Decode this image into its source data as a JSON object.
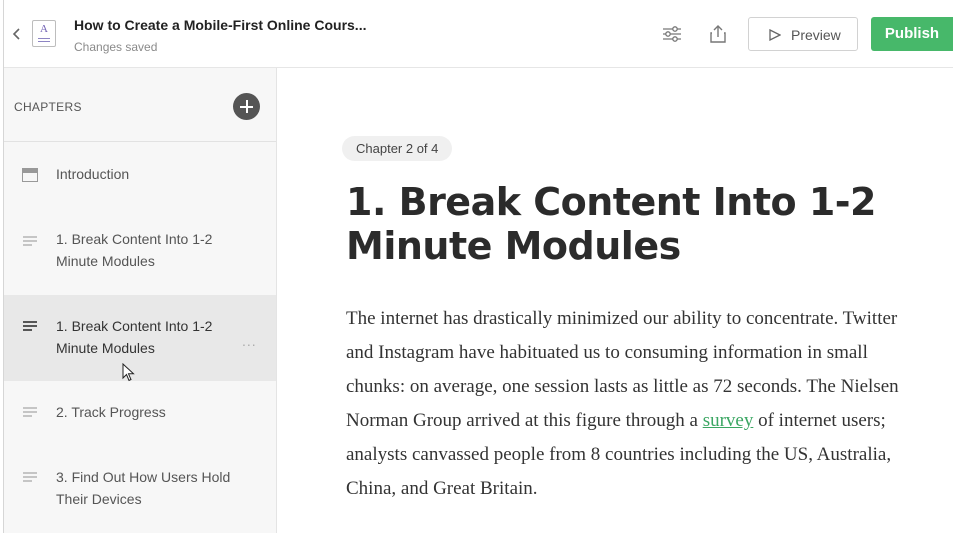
{
  "header": {
    "back_icon": "chevron-left-icon",
    "doc_icon_letter": "A",
    "title": "How to Create a Mobile-First Online Cours...",
    "subtitle": "Changes saved",
    "settings_icon": "sliders-icon",
    "share_icon": "share-icon",
    "preview_label": "Preview",
    "publish_label": "Publish",
    "publish_color": "#47b86a"
  },
  "sidebar": {
    "heading": "CHAPTERS",
    "add_icon": "plus-circle-icon",
    "items": [
      {
        "label": "Introduction",
        "icon": "card-icon",
        "active": false
      },
      {
        "label": "1. Break Content Into 1-2 Minute Modules",
        "icon": "lines-icon",
        "active": false
      },
      {
        "label": "1. Break Content Into 1-2 Minute Modules",
        "icon": "lines-icon",
        "active": true,
        "more": "..."
      },
      {
        "label": "2. Track Progress",
        "icon": "lines-icon",
        "active": false
      },
      {
        "label": "3. Find Out How Users Hold Their Devices",
        "icon": "lines-icon",
        "active": false
      }
    ]
  },
  "main": {
    "chapter_badge": "Chapter 2 of 4",
    "heading": "1. Break Content Into 1-2 Minute Modules",
    "paragraph_before_link": "The internet has drastically minimized our ability to concentrate. Twitter and Instagram have habituated us to consuming information in small chunks: on average, one session lasts as little as 72 seconds. The Nielsen Norman Group arrived at this figure through a ",
    "link_text": "survey",
    "paragraph_after_link": " of internet users; analysts canvassed people from 8 countries including the US, Australia, China, and Great Britain.",
    "link_color": "#3aa662"
  }
}
